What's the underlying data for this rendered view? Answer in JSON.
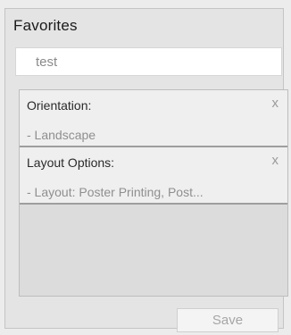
{
  "panel": {
    "title": "Favorites",
    "name_input": {
      "value": "test"
    }
  },
  "list": {
    "items": [
      {
        "title": "Orientation:",
        "value": "- Landscape",
        "remove_glyph": "x",
        "remove_icon": "close-icon"
      },
      {
        "title": "Layout Options:",
        "value": "- Layout: Poster Printing, Post...",
        "remove_glyph": "x",
        "remove_icon": "close-icon"
      }
    ]
  },
  "footer": {
    "save_label": "Save"
  }
}
